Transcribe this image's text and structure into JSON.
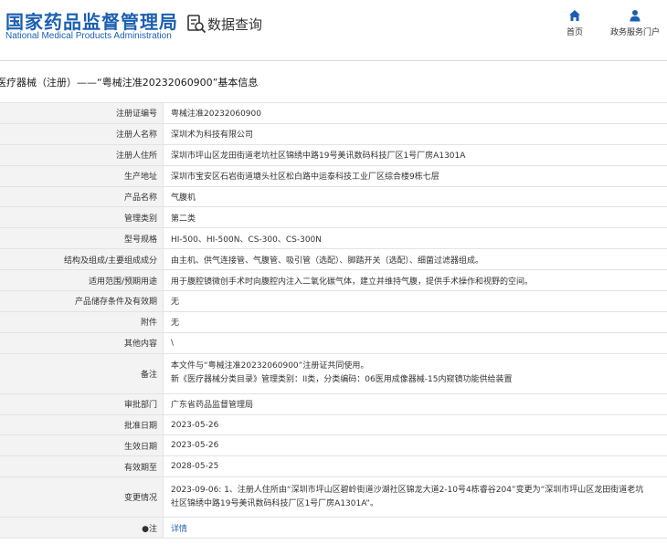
{
  "header": {
    "logo_cn": "国家药品监督管理局",
    "logo_en": "National Medical Products Administration",
    "query_title": "数据查询",
    "nav": {
      "home_label": "首页",
      "user_label": "政务服务门户"
    }
  },
  "breadcrumb": "医疗器械（注册）——“粤械注准20232060900”基本信息",
  "rows": [
    {
      "label": "注册证编号",
      "value": "粤械注准20232060900"
    },
    {
      "label": "注册人名称",
      "value": "深圳术为科技有限公司"
    },
    {
      "label": "注册人住所",
      "value": "深圳市坪山区龙田街道老坑社区锦绣中路19号美讯数码科技厂区1号厂房A1301A"
    },
    {
      "label": "生产地址",
      "value": "深圳市宝安区石岩街道塘头社区松白路中运泰科技工业厂区综合楼9栋七层"
    },
    {
      "label": "产品名称",
      "value": "气腹机"
    },
    {
      "label": "管理类别",
      "value": "第二类"
    },
    {
      "label": "型号规格",
      "value": "HI-500、HI-500N、CS-300、CS-300N"
    },
    {
      "label": "结构及组成/主要组成成分",
      "value": "由主机、供气连接管、气腹管、吸引管（选配）、脚踏开关（选配）、细菌过滤器组成。"
    },
    {
      "label": "适用范围/预期用途",
      "value": "用于腹腔镜微创手术时向腹腔内注入二氧化碳气体，建立并维持气腹，提供手术操作和视野的空间。"
    },
    {
      "label": "产品储存条件及有效期",
      "value": "无"
    },
    {
      "label": "附件",
      "value": "无"
    },
    {
      "label": "其他内容",
      "value": "\\"
    },
    {
      "label": "备注",
      "lines": [
        "本文件与“粤械注准20232060900”注册证共同使用。",
        "新《医疗器械分类目录》管理类别：II类，分类编码：06医用成像器械-15内窥镜功能供给装置"
      ]
    },
    {
      "label": "审批部门",
      "value": "广东省药品监督管理局"
    },
    {
      "label": "批准日期",
      "value": "2023-05-26"
    },
    {
      "label": "生效日期",
      "value": "2023-05-26"
    },
    {
      "label": "有效期至",
      "value": "2028-05-25"
    },
    {
      "label": "变更情况",
      "lines": [
        "2023-09-06: 1、注册人住所由“深圳市坪山区碧岭街道沙湖社区锦龙大道2-10号4栋睿谷204”变更为“深圳市坪山区龙田街道老坑",
        "社区锦绣中路19号美讯数码科技厂区1号厂房A1301A”。"
      ]
    },
    {
      "label": "注",
      "value": "详情",
      "link": true
    }
  ],
  "colors": {
    "brand_blue": "#1b5fb0",
    "label_bg": "#f3f3f3",
    "link": "#2a62b0"
  }
}
